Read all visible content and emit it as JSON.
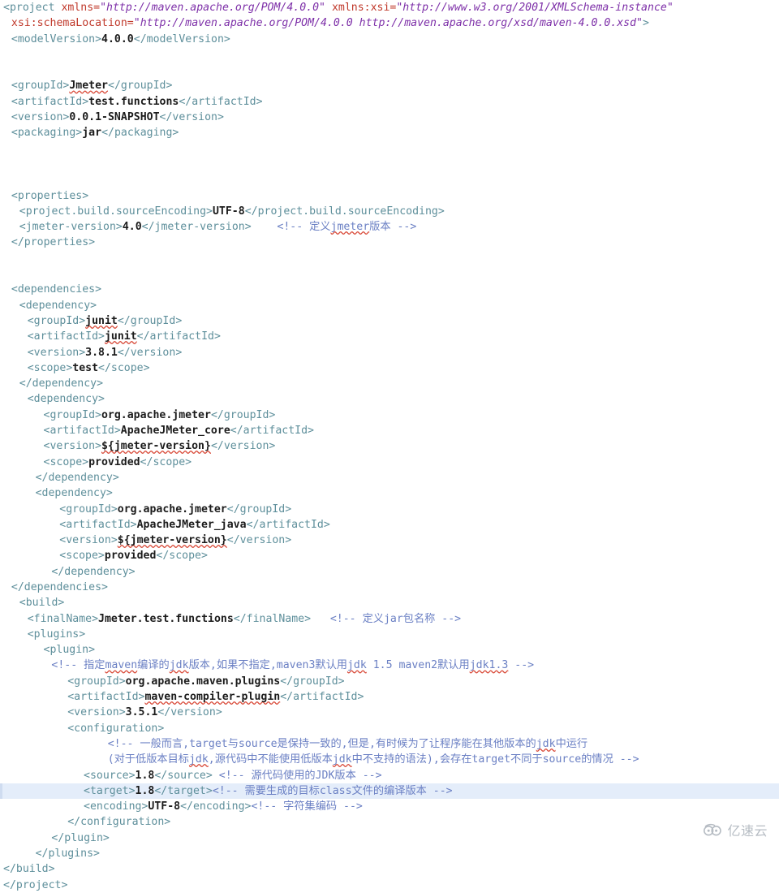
{
  "editor": {
    "language": "xml",
    "file_kind": "maven-pom",
    "highlighted_line_number": 48,
    "colors": {
      "background": "#ffffff",
      "tag": "#5e8f9b",
      "text_content": "#1b1b1b",
      "attribute_name": "#c0392b",
      "attribute_value": "#7d2fa8",
      "comment": "#6b80c4",
      "current_line_highlight": "#e4edfa",
      "spellcheck_underline": "#d94b3a"
    }
  },
  "watermark": {
    "text": "亿速云",
    "icon": "cloud-icon"
  },
  "lines": [
    {
      "n": 1,
      "indent": 0,
      "parts": [
        {
          "t": "tag",
          "s": "<project "
        },
        {
          "t": "attr",
          "s": "xmlns="
        },
        {
          "t": "val",
          "s": "\"http://maven.apache.org/POM/4.0.0\""
        },
        {
          "t": "tag",
          "s": " "
        },
        {
          "t": "attr",
          "s": "xmlns:xsi="
        },
        {
          "t": "val",
          "s": "\"http://www.w3.org/2001/XMLSchema-instance\""
        }
      ]
    },
    {
      "n": 2,
      "indent": 1,
      "parts": [
        {
          "t": "attr",
          "s": "xsi:schemaLocation="
        },
        {
          "t": "val",
          "s": "\"http://maven.apache.org/POM/4.0.0 http://maven.apache.org/xsd/maven-4.0.0.xsd\""
        },
        {
          "t": "tag",
          "s": ">"
        }
      ]
    },
    {
      "n": 3,
      "indent": 1,
      "parts": [
        {
          "t": "tag",
          "s": "<modelVersion>"
        },
        {
          "t": "txt",
          "s": "4.0.0"
        },
        {
          "t": "tag",
          "s": "</modelVersion>"
        }
      ]
    },
    {
      "n": 4,
      "indent": 0,
      "parts": []
    },
    {
      "n": 5,
      "indent": 0,
      "parts": []
    },
    {
      "n": 6,
      "indent": 1,
      "parts": [
        {
          "t": "tag",
          "s": "<groupId>"
        },
        {
          "t": "txt",
          "s": "Jmeter",
          "sq": true
        },
        {
          "t": "tag",
          "s": "</groupId>"
        }
      ]
    },
    {
      "n": 7,
      "indent": 1,
      "parts": [
        {
          "t": "tag",
          "s": "<artifactId>"
        },
        {
          "t": "txt",
          "s": "test.functions"
        },
        {
          "t": "tag",
          "s": "</artifactId>"
        }
      ]
    },
    {
      "n": 8,
      "indent": 1,
      "parts": [
        {
          "t": "tag",
          "s": "<version>"
        },
        {
          "t": "txt",
          "s": "0.0.1-SNAPSHOT"
        },
        {
          "t": "tag",
          "s": "</version>"
        }
      ]
    },
    {
      "n": 9,
      "indent": 1,
      "parts": [
        {
          "t": "tag",
          "s": "<packaging>"
        },
        {
          "t": "txt",
          "s": "jar"
        },
        {
          "t": "tag",
          "s": "</packaging>"
        }
      ]
    },
    {
      "n": 10,
      "indent": 0,
      "parts": []
    },
    {
      "n": 11,
      "indent": 0,
      "parts": []
    },
    {
      "n": 12,
      "indent": 0,
      "parts": []
    },
    {
      "n": 13,
      "indent": 1,
      "parts": [
        {
          "t": "tag",
          "s": "<properties>"
        }
      ]
    },
    {
      "n": 14,
      "indent": 2,
      "parts": [
        {
          "t": "tag",
          "s": "<project.build.sourceEncoding>"
        },
        {
          "t": "txt",
          "s": "UTF-8"
        },
        {
          "t": "tag",
          "s": "</project.build.sourceEncoding>"
        }
      ]
    },
    {
      "n": 15,
      "indent": 2,
      "parts": [
        {
          "t": "tag",
          "s": "<jmeter-version>"
        },
        {
          "t": "txt",
          "s": "4.0"
        },
        {
          "t": "tag",
          "s": "</jmeter-version>"
        },
        {
          "t": "cmt",
          "s": "    <!-- 定义"
        },
        {
          "t": "cmt",
          "s": "jmeter",
          "sq": true
        },
        {
          "t": "cmt",
          "s": "版本 -->"
        }
      ]
    },
    {
      "n": 16,
      "indent": 1,
      "parts": [
        {
          "t": "tag",
          "s": "</properties>"
        }
      ]
    },
    {
      "n": 17,
      "indent": 0,
      "parts": []
    },
    {
      "n": 18,
      "indent": 0,
      "parts": []
    },
    {
      "n": 19,
      "indent": 1,
      "parts": [
        {
          "t": "tag",
          "s": "<dependencies>"
        }
      ]
    },
    {
      "n": 20,
      "indent": 2,
      "parts": [
        {
          "t": "tag",
          "s": "<dependency>"
        }
      ]
    },
    {
      "n": 21,
      "indent": 3,
      "parts": [
        {
          "t": "tag",
          "s": "<groupId>"
        },
        {
          "t": "txt",
          "s": "junit",
          "sq": true
        },
        {
          "t": "tag",
          "s": "</groupId>"
        }
      ]
    },
    {
      "n": 22,
      "indent": 3,
      "parts": [
        {
          "t": "tag",
          "s": "<artifactId>"
        },
        {
          "t": "txt",
          "s": "junit",
          "sq": true
        },
        {
          "t": "tag",
          "s": "</artifactId>"
        }
      ]
    },
    {
      "n": 23,
      "indent": 3,
      "parts": [
        {
          "t": "tag",
          "s": "<version>"
        },
        {
          "t": "txt",
          "s": "3.8.1"
        },
        {
          "t": "tag",
          "s": "</version>"
        }
      ]
    },
    {
      "n": 24,
      "indent": 3,
      "parts": [
        {
          "t": "tag",
          "s": "<scope>"
        },
        {
          "t": "txt",
          "s": "test"
        },
        {
          "t": "tag",
          "s": "</scope>"
        }
      ]
    },
    {
      "n": 25,
      "indent": 2,
      "parts": [
        {
          "t": "tag",
          "s": "</dependency>"
        }
      ]
    },
    {
      "n": 26,
      "indent": 3,
      "parts": [
        {
          "t": "tag",
          "s": "<dependency>"
        }
      ]
    },
    {
      "n": 27,
      "indent": 5,
      "parts": [
        {
          "t": "tag",
          "s": "<groupId>"
        },
        {
          "t": "txt",
          "s": "org.apache.jmeter"
        },
        {
          "t": "tag",
          "s": "</groupId>"
        }
      ]
    },
    {
      "n": 28,
      "indent": 5,
      "parts": [
        {
          "t": "tag",
          "s": "<artifactId>"
        },
        {
          "t": "txt",
          "s": "ApacheJMeter_core"
        },
        {
          "t": "tag",
          "s": "</artifactId>"
        }
      ]
    },
    {
      "n": 29,
      "indent": 5,
      "parts": [
        {
          "t": "tag",
          "s": "<version>"
        },
        {
          "t": "txt",
          "s": "${jmeter-version}",
          "sq": true
        },
        {
          "t": "tag",
          "s": "</version>"
        }
      ]
    },
    {
      "n": 30,
      "indent": 5,
      "parts": [
        {
          "t": "tag",
          "s": "<scope>"
        },
        {
          "t": "txt",
          "s": "provided"
        },
        {
          "t": "tag",
          "s": "</scope>"
        }
      ]
    },
    {
      "n": 31,
      "indent": 4,
      "parts": [
        {
          "t": "tag",
          "s": "</dependency>"
        }
      ]
    },
    {
      "n": 32,
      "indent": 4,
      "parts": [
        {
          "t": "tag",
          "s": "<dependency>"
        }
      ]
    },
    {
      "n": 33,
      "indent": 7,
      "parts": [
        {
          "t": "tag",
          "s": "<groupId>"
        },
        {
          "t": "txt",
          "s": "org.apache.jmeter"
        },
        {
          "t": "tag",
          "s": "</groupId>"
        }
      ]
    },
    {
      "n": 34,
      "indent": 7,
      "parts": [
        {
          "t": "tag",
          "s": "<artifactId>"
        },
        {
          "t": "txt",
          "s": "ApacheJMeter_java"
        },
        {
          "t": "tag",
          "s": "</artifactId>"
        }
      ]
    },
    {
      "n": 35,
      "indent": 7,
      "parts": [
        {
          "t": "tag",
          "s": "<version>"
        },
        {
          "t": "txt",
          "s": "${jmeter-version}",
          "sq": true
        },
        {
          "t": "tag",
          "s": "</version>"
        }
      ]
    },
    {
      "n": 36,
      "indent": 7,
      "parts": [
        {
          "t": "tag",
          "s": "<scope>"
        },
        {
          "t": "txt",
          "s": "provided"
        },
        {
          "t": "tag",
          "s": "</scope>"
        }
      ]
    },
    {
      "n": 37,
      "indent": 6,
      "parts": [
        {
          "t": "tag",
          "s": "</dependency>"
        }
      ]
    },
    {
      "n": 38,
      "indent": 1,
      "parts": [
        {
          "t": "tag",
          "s": "</dependencies>"
        }
      ]
    },
    {
      "n": 39,
      "indent": 2,
      "parts": [
        {
          "t": "tag",
          "s": "<build>"
        }
      ]
    },
    {
      "n": 40,
      "indent": 3,
      "parts": [
        {
          "t": "tag",
          "s": "<finalName>"
        },
        {
          "t": "txt",
          "s": "Jmeter.test.functions"
        },
        {
          "t": "tag",
          "s": "</finalName>"
        },
        {
          "t": "cmt",
          "s": "   <!-- 定义jar包名称 -->"
        }
      ]
    },
    {
      "n": 41,
      "indent": 3,
      "parts": [
        {
          "t": "tag",
          "s": "<plugins>"
        }
      ]
    },
    {
      "n": 42,
      "indent": 5,
      "parts": [
        {
          "t": "tag",
          "s": "<plugin>"
        }
      ]
    },
    {
      "n": 43,
      "indent": 6,
      "parts": [
        {
          "t": "cmt",
          "s": "<!-- 指定"
        },
        {
          "t": "cmt",
          "s": "maven",
          "sq": true
        },
        {
          "t": "cmt",
          "s": "编译的"
        },
        {
          "t": "cmt",
          "s": "jdk",
          "sq": true
        },
        {
          "t": "cmt",
          "s": "版本,如果不指定,maven3默认用"
        },
        {
          "t": "cmt",
          "s": "jdk",
          "sq": true
        },
        {
          "t": "cmt",
          "s": " 1.5 maven2默认用"
        },
        {
          "t": "cmt",
          "s": "jdk1.3",
          "sq": true
        },
        {
          "t": "cmt",
          "s": " -->"
        }
      ]
    },
    {
      "n": 44,
      "indent": 8,
      "parts": [
        {
          "t": "tag",
          "s": "<groupId>"
        },
        {
          "t": "txt",
          "s": "org.apache.maven.plugins"
        },
        {
          "t": "tag",
          "s": "</groupId>"
        }
      ]
    },
    {
      "n": 45,
      "indent": 8,
      "parts": [
        {
          "t": "tag",
          "s": "<artifactId>"
        },
        {
          "t": "txt",
          "s": "maven-compiler-plugin",
          "sq": true
        },
        {
          "t": "tag",
          "s": "</artifactId>"
        }
      ]
    },
    {
      "n": 46,
      "indent": 8,
      "parts": [
        {
          "t": "tag",
          "s": "<version>"
        },
        {
          "t": "txt",
          "s": "3.5.1"
        },
        {
          "t": "tag",
          "s": "</version>"
        }
      ]
    },
    {
      "n": 47,
      "indent": 8,
      "parts": [
        {
          "t": "tag",
          "s": "<configuration>"
        }
      ]
    },
    {
      "n": 48,
      "indent": 13,
      "parts": [
        {
          "t": "cmt",
          "s": "<!-- 一般而言,target与source是保持一致的,但是,有时候为了让程序能在其他版本的"
        },
        {
          "t": "cmt",
          "s": "jdk",
          "sq": true
        },
        {
          "t": "cmt",
          "s": "中运行"
        }
      ]
    },
    {
      "n": 49,
      "indent": 13,
      "parts": [
        {
          "t": "cmt",
          "s": "(对于低版本目标"
        },
        {
          "t": "cmt",
          "s": "jdk",
          "sq": true
        },
        {
          "t": "cmt",
          "s": ",源代码中不能使用低版本"
        },
        {
          "t": "cmt",
          "s": "jdk",
          "sq": true
        },
        {
          "t": "cmt",
          "s": "中不支持的语法),会存在target不同于source的情况 -->"
        }
      ]
    },
    {
      "n": 50,
      "indent": 10,
      "parts": [
        {
          "t": "tag",
          "s": "<source>"
        },
        {
          "t": "txt",
          "s": "1.8"
        },
        {
          "t": "tag",
          "s": "</source>"
        },
        {
          "t": "cmt",
          "s": " <!-- 源代码使用的JDK版本 -->"
        }
      ]
    },
    {
      "n": 51,
      "indent": 10,
      "highlight": true,
      "parts": [
        {
          "t": "tag",
          "s": "<target>"
        },
        {
          "t": "txt",
          "s": "1.8"
        },
        {
          "t": "tag",
          "s": "</target>"
        },
        {
          "t": "cmt",
          "s": "<!-- 需要生成的目标class文件的编译版本 -->"
        }
      ]
    },
    {
      "n": 52,
      "indent": 10,
      "parts": [
        {
          "t": "tag",
          "s": "<encoding>"
        },
        {
          "t": "txt",
          "s": "UTF-8"
        },
        {
          "t": "tag",
          "s": "</encoding>"
        },
        {
          "t": "cmt",
          "s": "<!-- 字符集编码 -->"
        }
      ]
    },
    {
      "n": 53,
      "indent": 8,
      "parts": [
        {
          "t": "tag",
          "s": "</configuration>"
        }
      ]
    },
    {
      "n": 54,
      "indent": 6,
      "parts": [
        {
          "t": "tag",
          "s": "</plugin>"
        }
      ]
    },
    {
      "n": 55,
      "indent": 4,
      "parts": [
        {
          "t": "tag",
          "s": "</plugins>"
        }
      ]
    },
    {
      "n": 56,
      "indent": 0,
      "parts": [
        {
          "t": "tag",
          "s": "</build>"
        }
      ]
    },
    {
      "n": 57,
      "indent": 0,
      "parts": [
        {
          "t": "tag",
          "s": "</project>"
        }
      ]
    }
  ]
}
